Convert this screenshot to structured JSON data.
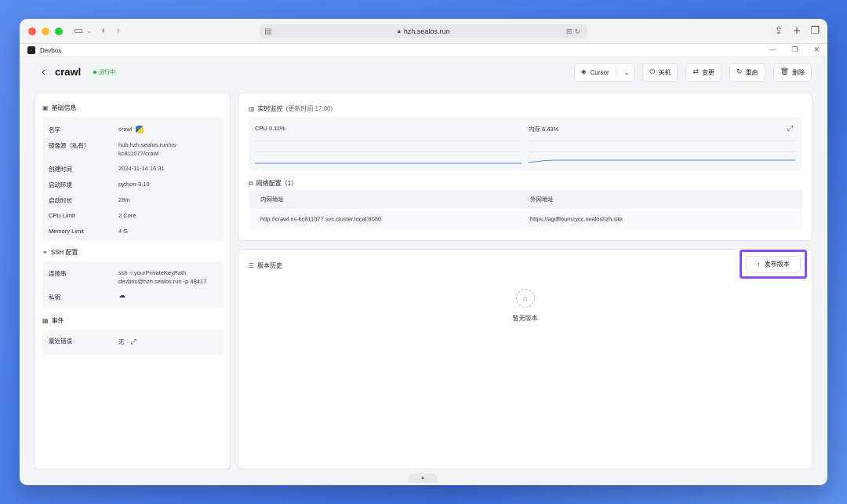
{
  "browser": {
    "url": "hzh.sealos.run"
  },
  "app": {
    "name": "Devbox"
  },
  "header": {
    "title": "crawl",
    "status": "运行中",
    "actions": {
      "cursor": "Cursor",
      "shutdown": "关机",
      "change": "变更",
      "restart": "重启",
      "delete": "删除"
    }
  },
  "basic": {
    "title": "基础信息",
    "rows": [
      {
        "label": "名字",
        "value": "crawl"
      },
      {
        "label": "镜像源（私有）",
        "value": "hub.hzh.sealos.run/ns-\nkc811077/crawl"
      },
      {
        "label": "创建时间",
        "value": "2024-11-14 16:31"
      },
      {
        "label": "启动环境",
        "value": "python-3.10"
      },
      {
        "label": "启动时长",
        "value": "28m"
      },
      {
        "label": "CPU Limit",
        "value": "2 Core"
      },
      {
        "label": "Memory Limit",
        "value": "4 G"
      }
    ]
  },
  "ssh": {
    "title": "SSH 配置",
    "connect_label": "连接串",
    "connect_value": "ssh -i yourPrivateKeyPath\ndevbox@hzh.sealos.run -p 48417",
    "key_label": "私钥"
  },
  "events": {
    "title": "事件",
    "recent_error_label": "最近错误",
    "recent_error_value": "无"
  },
  "monitor": {
    "title": "实时监控",
    "updated": "(更新时间  17:00)",
    "cpu": "CPU 0.11%",
    "mem": "内存 6.43%",
    "cpu_percent": 0.11,
    "mem_percent": 6.43
  },
  "network": {
    "title": "网络配置（1）",
    "headers": [
      "内网地址",
      "外网地址"
    ],
    "rows": [
      [
        "http://crawl.ns-kc811077.svc.cluster.local:8080",
        "https://agdfloumzycc.sealoshzh.site"
      ]
    ]
  },
  "versions": {
    "title": "版本历史",
    "publish": "发布版本",
    "empty": "暂无版本"
  },
  "colors": {
    "accent": "#8a4cf0",
    "status": "#22b35e",
    "chart_line": "#4a90e2"
  }
}
